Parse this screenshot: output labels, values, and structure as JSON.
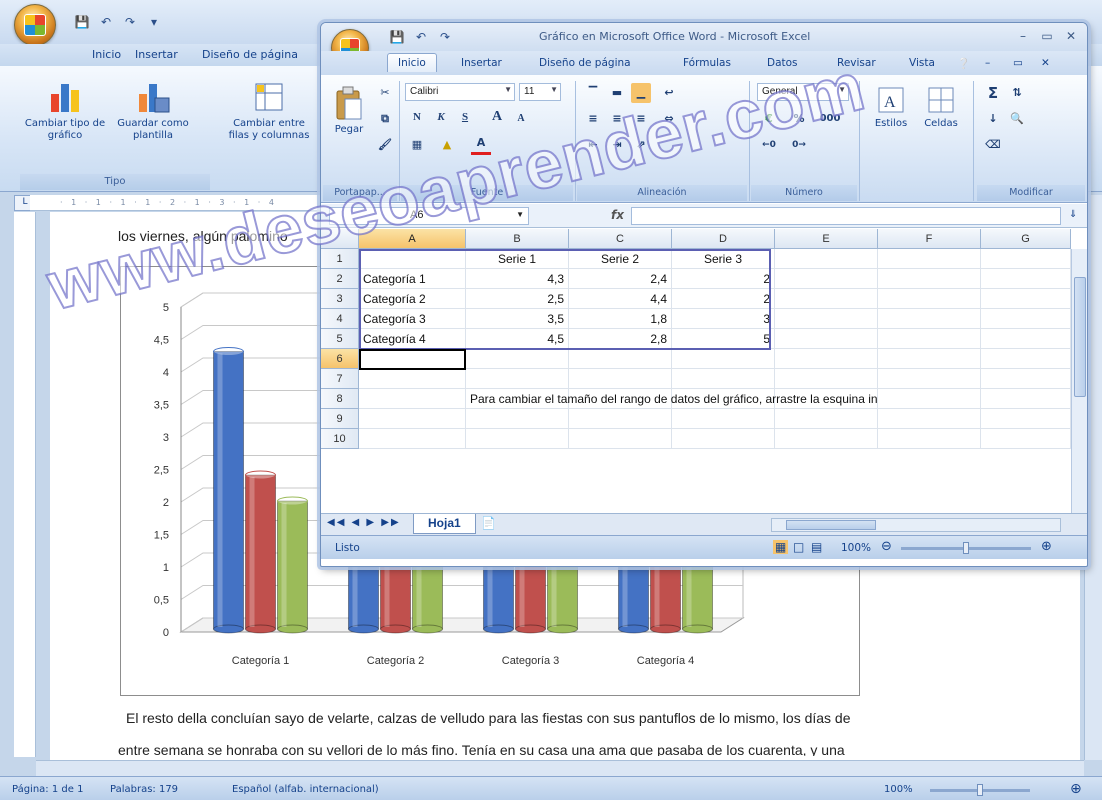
{
  "word": {
    "qat": [
      "save-icon",
      "undo-icon",
      "redo-icon"
    ],
    "tabs": [
      "Inicio",
      "Insertar",
      "Diseño de página"
    ],
    "ribbon": {
      "buttons": [
        {
          "label": "Cambiar tipo de gráfico"
        },
        {
          "label": "Guardar como plantilla"
        },
        {
          "label": "Cambiar entre filas y columnas"
        }
      ],
      "group_tipo": "Tipo"
    },
    "ruler_text": "· 1 · 1 · 1 · 1 · 2 · 1 · 3 · 1 · 4",
    "doc_line_top": "los viernes, algún palomino",
    "doc_para": "El resto della concluían sayo de velarte, calzas de velludo para las fiestas con sus pantuflos de lo mismo, los días de",
    "doc_para2": "entre semana se honraba con su vellori de lo más fino. Tenía en su casa una ama que pasaba de los cuarenta, y una",
    "status": {
      "page": "Página: 1 de 1",
      "words": "Palabras: 179",
      "language": "Español (alfab. internacional)",
      "zoom": "100%"
    }
  },
  "excel": {
    "title": "Gráfico en Microsoft Office Word - Microsoft Excel",
    "tabs": [
      "Inicio",
      "Insertar",
      "Diseño de página",
      "Fórmulas",
      "Datos",
      "Revisar",
      "Vista"
    ],
    "ribbon": {
      "paste": "Pegar",
      "portapapeles": "Portapap...",
      "font_name": "Calibri",
      "font_size": "11",
      "bold": "N",
      "italic": "K",
      "underline": "S",
      "grow": "A",
      "fuente": "Fuente",
      "alineacion": "Alineación",
      "number_format": "General",
      "percent": "%",
      "thousands": "000",
      "numero": "Número",
      "estilos": "Estilos",
      "celdas": "Celdas",
      "modificar": "Modificar",
      "sigma": "Σ"
    },
    "namebox": "A6",
    "fx": "fx",
    "columns": [
      "A",
      "B",
      "C",
      "D",
      "E",
      "F",
      "G"
    ],
    "rows": [
      [
        "",
        "Serie 1",
        "Serie 2",
        "Serie 3"
      ],
      [
        "Categoría 1",
        "4,3",
        "2,4",
        "2"
      ],
      [
        "Categoría 2",
        "2,5",
        "4,4",
        "2"
      ],
      [
        "Categoría 3",
        "3,5",
        "1,8",
        "3"
      ],
      [
        "Categoría 4",
        "4,5",
        "2,8",
        "5"
      ],
      [
        "",
        "",
        "",
        ""
      ],
      [
        "",
        "",
        "",
        ""
      ],
      [
        "",
        "",
        "",
        ""
      ],
      [
        "",
        "",
        "",
        ""
      ],
      [
        "",
        "",
        "",
        ""
      ]
    ],
    "row_numbers": [
      "1",
      "2",
      "3",
      "4",
      "5",
      "6",
      "7",
      "8",
      "9",
      "10"
    ],
    "row8_text": "Para cambiar el tamaño del rango de datos del gráfico, arrastre la esquina in",
    "sheet_tab": "Hoja1",
    "status_ready": "Listo",
    "zoom": "100%"
  },
  "watermark": "www.deseoaprender.com",
  "chart_data": {
    "type": "bar",
    "categories": [
      "Categoría 1",
      "Categoría 2",
      "Categoría 3",
      "Categoría 4"
    ],
    "series": [
      {
        "values": [
          4.3,
          2.5,
          3.5,
          4.5
        ],
        "color": "#4472c4"
      },
      {
        "values": [
          2.4,
          4.4,
          1.8,
          2.8
        ],
        "color": "#c0504d"
      },
      {
        "values": [
          2,
          2,
          3,
          5
        ],
        "color": "#9bbb59"
      }
    ],
    "ylim": [
      0,
      5
    ],
    "yticks": [
      "0",
      "0,5",
      "1",
      "1,5",
      "2",
      "2,5",
      "3",
      "3,5",
      "4",
      "4,5",
      "5"
    ],
    "grid": true
  }
}
